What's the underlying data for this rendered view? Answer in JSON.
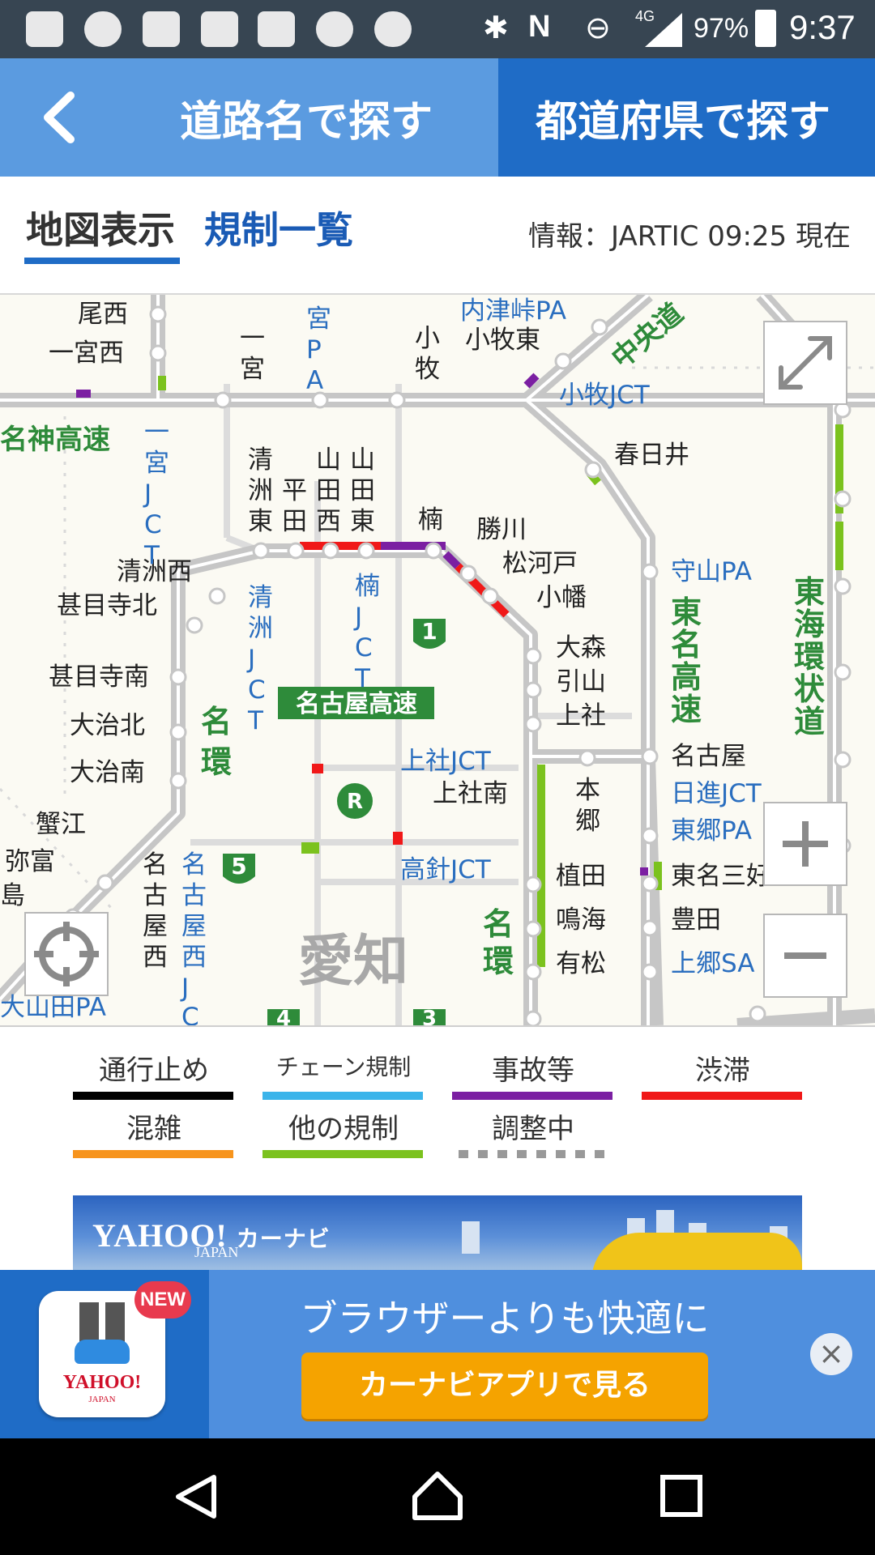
{
  "status_bar": {
    "network": "4G",
    "battery": "97%",
    "time": "9:37"
  },
  "header": {
    "back_icon": "chevron-left-icon",
    "road_search": "道路名で探す",
    "pref_search": "都道府県で探す"
  },
  "tabs": {
    "map_view": "地図表示",
    "regulation_list": "規制一覧",
    "info": "情報：JARTIC  09:25 現在"
  },
  "map": {
    "roads": {
      "meishin": "名神高速",
      "tomei": "東名高速",
      "tokai_kanjo": "東海環状道",
      "chuo": "中央道",
      "nagoya_expwy": "名古屋高速",
      "meikan": "名環",
      "meikan2": "名環"
    },
    "area": "愛知",
    "places": {
      "bisai": "尾西",
      "ichinomiya_nishi": "一宮西",
      "ichinomiya": "一宮",
      "ichinomiya_pa": "宮PA",
      "komaki": "小牧",
      "komaki_higashi": "小牧東",
      "utsutsutoge_pa": "内津峠PA",
      "komaki_jct": "小牧JCT",
      "kasugai": "春日井",
      "ichinomiya_jct": "一宮JCT",
      "kiyosu_higashi": "清洲東",
      "hirata": "平田",
      "yamada_nishi": "山田西",
      "yamada_higashi": "山田東",
      "kusunoki": "楠",
      "kachigawa": "勝川",
      "matsukawado": "松河戸",
      "obata": "小幡",
      "moriyama_pa": "守山PA",
      "kiyosu_nishi": "清洲西",
      "jimokuji_kita": "甚目寺北",
      "kiyosu_jct": "清洲JCT",
      "kusunoki_jct": "楠JCT",
      "omori": "大森",
      "hikiyama": "引山",
      "kamiyashiro": "上社",
      "jimokuji_minami": "甚目寺南",
      "oharu_kita": "大治北",
      "oharu_minami": "大治南",
      "kamiyashiro_jct": "上社JCT",
      "kamiyashiro_minami": "上社南",
      "nagoya": "名古屋",
      "nisshin_jct": "日進JCT",
      "togo_pa": "東郷PA",
      "tomei_miyoshi": "東名三好",
      "kanie": "蟹江",
      "yatomi": "弥富",
      "shima": "島",
      "nagoya_nishi": "名古屋西",
      "nagoya_nishi_jct": "名古屋西JCT",
      "hongo": "本郷",
      "takabari_jct": "高針JCT",
      "ueda": "植田",
      "narumi": "鳴海",
      "arimatsu": "有松",
      "toyota": "豊田",
      "kamigo_sa": "上郷SA",
      "ooyamada_pa": "大山田PA"
    },
    "route_shields": [
      "1",
      "5",
      "4",
      "3"
    ],
    "controls": {
      "expand_icon": "expand-icon",
      "locate_icon": "crosshair-icon",
      "zoom_in": "+",
      "zoom_out": "−"
    }
  },
  "legend": [
    {
      "label": "通行止め",
      "color": "#000000",
      "style": "solid"
    },
    {
      "label": "チェーン規制",
      "color": "#3bb4ea",
      "style": "solid"
    },
    {
      "label": "事故等",
      "color": "#7b1fa2",
      "style": "solid"
    },
    {
      "label": "渋滞",
      "color": "#f01818",
      "style": "solid"
    },
    {
      "label": "混雑",
      "color": "#f7941d",
      "style": "solid"
    },
    {
      "label": "他の規制",
      "color": "#7bc21e",
      "style": "solid"
    },
    {
      "label": "調整中",
      "color": "#999999",
      "style": "dashed"
    }
  ],
  "ad_banner": {
    "logo": "YAHOO!",
    "logo_sub": "JAPAN",
    "product": "カーナビ"
  },
  "promo": {
    "badge": "NEW",
    "app_logo": "YAHOO!",
    "app_logo_sub": "JAPAN",
    "headline": "ブラウザーよりも快適に",
    "button": "カーナビアプリで見る",
    "close_icon": "close-icon"
  },
  "nav_bar": {
    "back_icon": "back-triangle-icon",
    "home_icon": "home-icon",
    "recents_icon": "recents-square-icon"
  },
  "colors": {
    "header_light": "#5b9be0",
    "header_dark": "#1f6cc6",
    "jam": "#f01818",
    "incident": "#7b1fa2",
    "other_reg": "#7bc21e",
    "road_gray": "#c8c8c8"
  }
}
